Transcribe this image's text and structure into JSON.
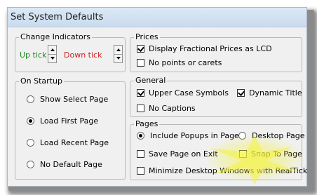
{
  "window": {
    "title": "Set System Defaults"
  },
  "change_indicators": {
    "legend": "Change Indicators",
    "up_label": "Up tick",
    "down_label": "Down tick",
    "up_color": "#1f8a1f",
    "down_color": "#d02020"
  },
  "on_startup": {
    "legend": "On Startup",
    "options": [
      {
        "label": "Show Select Page",
        "checked": false
      },
      {
        "label": "Load First Page",
        "checked": true
      },
      {
        "label": "Load Recent Page",
        "checked": false
      },
      {
        "label": "No Default Page",
        "checked": false
      }
    ]
  },
  "prices": {
    "legend": "Prices",
    "options": [
      {
        "label": "Display Fractional Prices as LCD",
        "checked": true
      },
      {
        "label": "No points or carets",
        "checked": false
      }
    ]
  },
  "general": {
    "legend": "General",
    "upper_case": {
      "label": "Upper Case Symbols",
      "checked": true
    },
    "dynamic_title": {
      "label": "Dynamic Title",
      "checked": true
    },
    "no_captions": {
      "label": "No Captions",
      "checked": false
    }
  },
  "pages": {
    "legend": "Pages",
    "include_popups": {
      "label": "Include Popups in Pages",
      "checked": true
    },
    "desktop_page": {
      "label": "Desktop Page",
      "checked": false
    },
    "save_page_on_exit": {
      "label": "Save Page on Exit",
      "checked": false
    },
    "snap_to_page": {
      "label": "Snap To Page",
      "checked": false
    },
    "minimize_desktop": {
      "label": "Minimize Desktop Windows with RealTick",
      "checked": false
    }
  },
  "highlight_color": "#f2f23a"
}
